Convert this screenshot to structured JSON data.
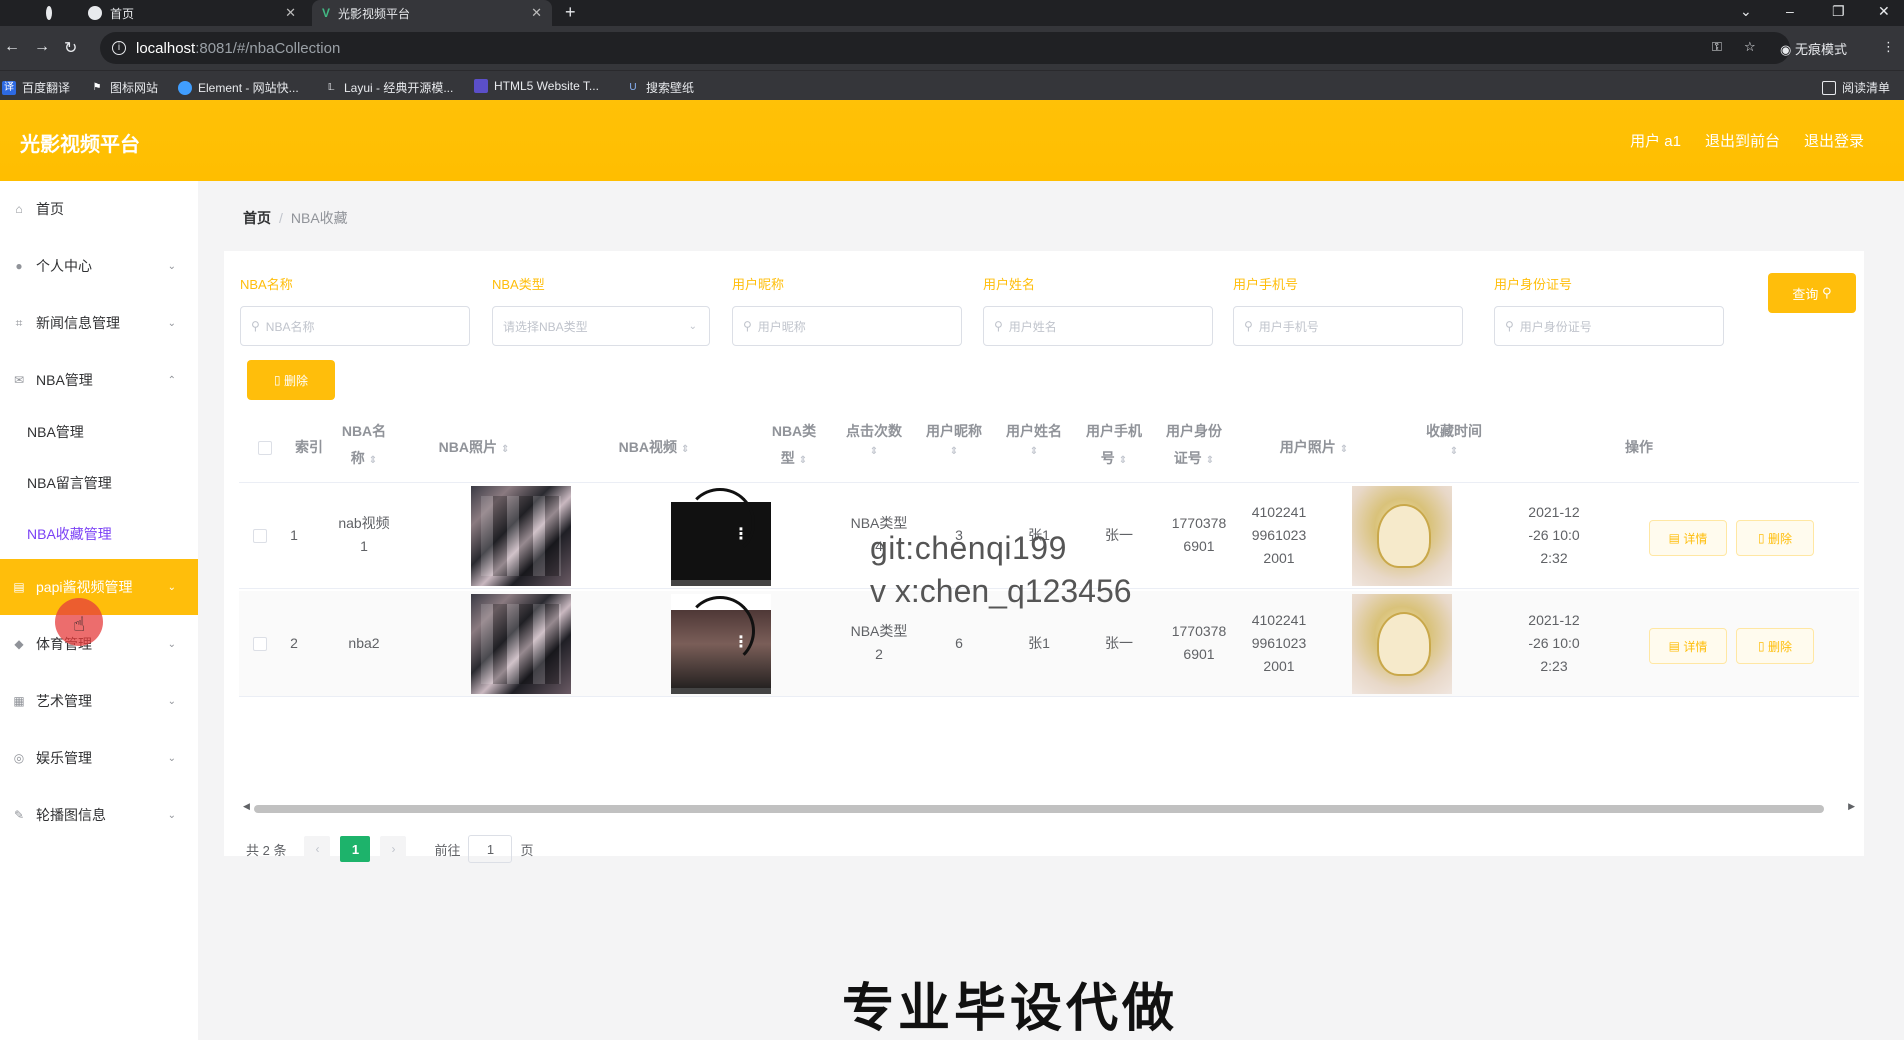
{
  "browser": {
    "tabs": [
      {
        "label": "首页"
      },
      {
        "label": "光影视频平台"
      }
    ],
    "url_host": "localhost",
    "url_path": ":8081/#/nbaCollection",
    "incognito_label": "无痕模式",
    "bookmarks": [
      "百度翻译",
      "图标网站",
      "Element - 网站快...",
      "Layui - 经典开源模...",
      "HTML5 Website T...",
      "搜索壁纸"
    ],
    "reading_list": "阅读清单"
  },
  "header": {
    "brand": "光影视频平台",
    "links": [
      "用户 a1",
      "退出到前台",
      "退出登录"
    ]
  },
  "sidebar": {
    "items": [
      {
        "label": "首页"
      },
      {
        "label": "个人中心"
      },
      {
        "label": "新闻信息管理"
      },
      {
        "label": "NBA管理"
      },
      {
        "label": "papi酱视频管理"
      },
      {
        "label": "体育管理"
      },
      {
        "label": "艺术管理"
      },
      {
        "label": "娱乐管理"
      },
      {
        "label": "轮播图信息"
      }
    ],
    "subitems": [
      "NBA管理",
      "NBA留言管理",
      "NBA收藏管理"
    ]
  },
  "breadcrumb": {
    "home": "首页",
    "separator": "/",
    "current": "NBA收藏"
  },
  "filters": [
    {
      "label": "NBA名称",
      "placeholder": "NBA名称"
    },
    {
      "label": "NBA类型",
      "placeholder": "请选择NBA类型"
    },
    {
      "label": "用户昵称",
      "placeholder": "用户昵称"
    },
    {
      "label": "用户姓名",
      "placeholder": "用户姓名"
    },
    {
      "label": "用户手机号",
      "placeholder": "用户手机号"
    },
    {
      "label": "用户身份证号",
      "placeholder": "用户身份证号"
    }
  ],
  "buttons": {
    "query": "查询",
    "delete": "删除",
    "detail": "详情",
    "row_delete": "删除"
  },
  "table": {
    "headers": {
      "index": "索引",
      "name_1": "NBA名",
      "name_2": "称",
      "photo": "NBA照片",
      "video": "NBA视频",
      "type_1": "NBA类",
      "type_2": "型",
      "clicks": "点击次数",
      "nick": "用户昵称",
      "uname": "用户姓名",
      "phone_1": "用户手机",
      "phone_2": "号",
      "idno_1": "用户身份",
      "idno_2": "证号",
      "uphoto": "用户照片",
      "time": "收藏时间",
      "ops": "操作"
    },
    "rows": [
      {
        "index": "1",
        "name_1": "nab视频",
        "name_2": "1",
        "type_1": "NBA类型",
        "type_2": "4",
        "clicks": "3",
        "nick": "张1",
        "uname": "张一",
        "phone_1": "1770378",
        "phone_2": "6901",
        "id_1": "4102241",
        "id_2": "9961023",
        "id_3": "2001",
        "time_1": "2021-12",
        "time_2": "-26 10:0",
        "time_3": "2:32"
      },
      {
        "index": "2",
        "name_1": "nba2",
        "name_2": "",
        "type_1": "NBA类型",
        "type_2": "2",
        "clicks": "6",
        "nick": "张1",
        "uname": "张一",
        "phone_1": "1770378",
        "phone_2": "6901",
        "id_1": "4102241",
        "id_2": "9961023",
        "id_3": "2001",
        "time_1": "2021-12",
        "time_2": "-26 10:0",
        "time_3": "2:23"
      }
    ]
  },
  "pagination": {
    "total": "共 2 条",
    "current": "1",
    "goto": "前往",
    "goto_value": "1",
    "page_unit": "页"
  },
  "watermark": {
    "line1": "git:chenqi199",
    "line2": "v x:chen_q123456"
  },
  "caption": "专业毕设代做",
  "colors": {
    "accent": "#ffbe0b",
    "pager_active": "#1db36b",
    "submenu_active": "#7b42f5"
  }
}
